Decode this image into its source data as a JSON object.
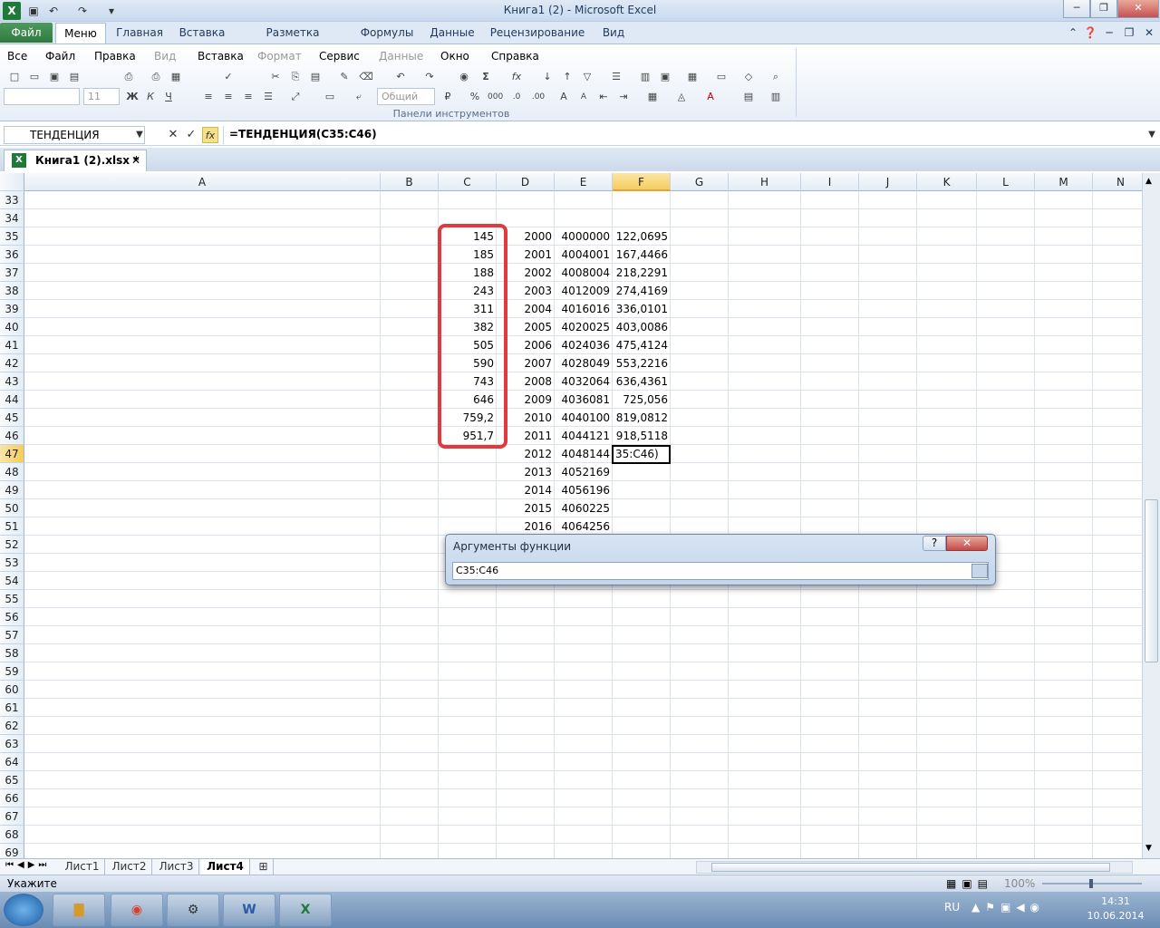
{
  "window": {
    "title": "Книга1 (2)  -  Microsoft Excel",
    "app_icon": "excel-icon"
  },
  "tabs": [
    "Файл",
    "Меню",
    "Главная",
    "Вставка",
    "Разметка страницы",
    "Формулы",
    "Данные",
    "Рецензирование",
    "Вид"
  ],
  "menu": [
    "Все",
    "Файл",
    "Правка",
    "Вид",
    "Вставка",
    "Формат",
    "Сервис",
    "Данные",
    "Окно",
    "Справка"
  ],
  "ribbon": {
    "font_size": "11",
    "number_format": "Общий",
    "group_label": "Панели инструментов"
  },
  "formula_bar": {
    "name_box": "ТЕНДЕНЦИЯ",
    "formula": "=ТЕНДЕНЦИЯ(C35:C46)"
  },
  "document_tab": {
    "label": "Книга1 (2).xlsx  *"
  },
  "columns": [
    "A",
    "B",
    "C",
    "D",
    "E",
    "F",
    "G",
    "H",
    "I",
    "J",
    "K",
    "L",
    "M",
    "N"
  ],
  "selected_column": "F",
  "rows": [
    "33",
    "34",
    "35",
    "36",
    "37",
    "38",
    "39",
    "40",
    "41",
    "42",
    "43",
    "44",
    "45",
    "46",
    "47",
    "48",
    "49",
    "50",
    "51",
    "52",
    "53",
    "54",
    "55",
    "56",
    "57",
    "58",
    "59",
    "60",
    "61",
    "62",
    "63",
    "64",
    "65",
    "66",
    "67",
    "68",
    "69"
  ],
  "selected_row": "47",
  "column_c": [
    "145",
    "185",
    "188",
    "243",
    "311",
    "382",
    "505",
    "590",
    "743",
    "646",
    "759,2",
    "951,7"
  ],
  "column_d": [
    "2000",
    "2001",
    "2002",
    "2003",
    "2004",
    "2005",
    "2006",
    "2007",
    "2008",
    "2009",
    "2010",
    "2011",
    "2012",
    "2013",
    "2014",
    "2015",
    "2016"
  ],
  "column_e": [
    "4000000",
    "4004001",
    "4008004",
    "4012009",
    "4016016",
    "4020025",
    "4024036",
    "4028049",
    "4032064",
    "4036081",
    "4040100",
    "4044121",
    "4048144",
    "4052169",
    "4056196",
    "4060225",
    "4064256"
  ],
  "column_f": [
    "122,0695",
    "167,4466",
    "218,2291",
    "274,4169",
    "336,0101",
    "403,0086",
    "475,4124",
    "553,2216",
    "636,4361",
    "725,056",
    "819,0812",
    "918,5118"
  ],
  "active_cell": {
    "ref": "F47",
    "content": "35:C46)"
  },
  "dialog": {
    "title": "Аргументы функции",
    "input": "C35:C46",
    "help_label": "?",
    "close_label": "✕"
  },
  "sheet_tabs": [
    "Лист1",
    "Лист2",
    "Лист3",
    "Лист4"
  ],
  "active_sheet": "Лист4",
  "status": {
    "mode": "Укажите",
    "zoom": "100%"
  },
  "taskbar": {
    "lang": "RU",
    "time": "14:31",
    "date": "10.06.2014"
  }
}
